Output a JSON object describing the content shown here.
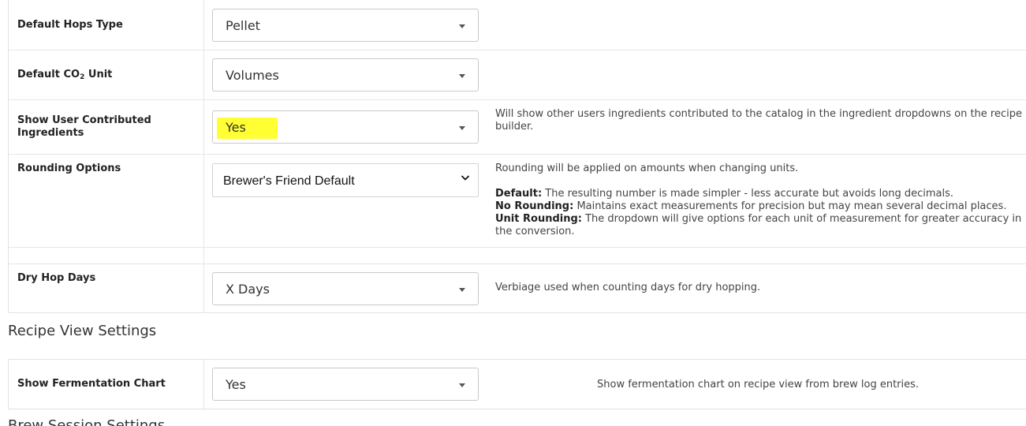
{
  "settings": {
    "hops_type": {
      "label": "Default Hops Type",
      "value": "Pellet"
    },
    "co2_unit": {
      "label_prefix": "Default CO",
      "label_sub": "2",
      "label_suffix": " Unit",
      "value": "Volumes"
    },
    "user_ingredients": {
      "label": "Show User Contributed Ingredients",
      "value": "Yes",
      "description": "Will show other users ingredients contributed to the catalog in the ingredient dropdowns on the recipe builder."
    },
    "rounding": {
      "label": "Rounding Options",
      "value": "Brewer's Friend Default",
      "intro": "Rounding will be applied on amounts when changing units.",
      "default_term": "Default:",
      "default_text": " The resulting number is made simpler - less accurate but avoids long decimals.",
      "none_term": "No Rounding:",
      "none_text": " Maintains exact measurements for precision but may mean several decimal places.",
      "unit_term": "Unit Rounding:",
      "unit_text": " The dropdown will give options for each unit of measurement for greater accuracy in the conversion."
    },
    "dry_hop": {
      "label": "Dry Hop Days",
      "value": "X Days",
      "description": "Verbiage used when counting days for dry hopping."
    }
  },
  "recipe_view": {
    "title": "Recipe View Settings",
    "fermentation_chart": {
      "label": "Show Fermentation Chart",
      "value": "Yes",
      "description": "Show fermentation chart on recipe view from brew log entries."
    }
  },
  "brew_session": {
    "title": "Brew Session Settings"
  }
}
